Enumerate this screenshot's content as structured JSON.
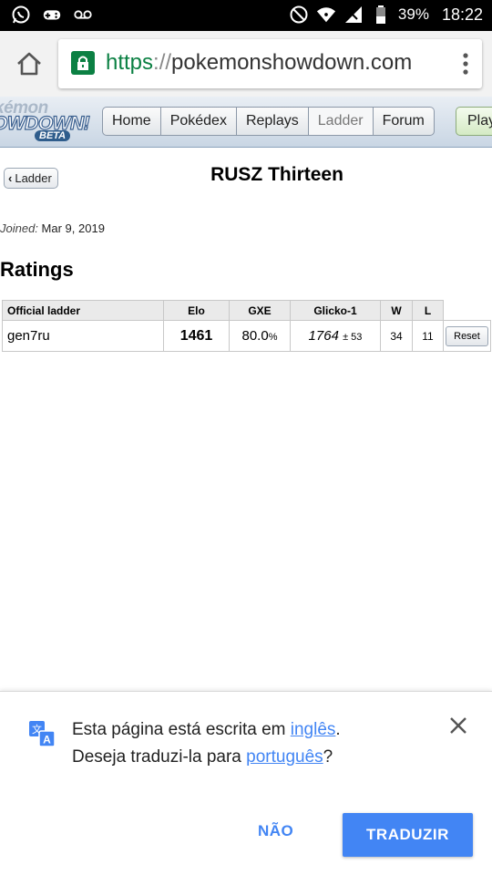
{
  "status_bar": {
    "battery": "39%",
    "time": "18:22",
    "icons": [
      "whatsapp-icon",
      "game-controller-icon",
      "voicemail-icon",
      "do-not-disturb-icon",
      "wifi-icon",
      "signal-icon",
      "battery-icon"
    ]
  },
  "browser": {
    "url_scheme": "https",
    "url_sep": "://",
    "url_host": "pokemonshowdown.com",
    "colors": {
      "secure": "#0b8043"
    }
  },
  "site_header": {
    "logo_line1": "kémon",
    "logo_line2": "OWDOWN!",
    "logo_line3": "BETA",
    "nav": [
      "Home",
      "Pokédex",
      "Replays",
      "Ladder",
      "Forum"
    ],
    "current_nav": "Ladder",
    "play_label": "Play"
  },
  "profile": {
    "back_label": "Ladder",
    "username": "RUSZ Thirteen",
    "joined_label": "Joined:",
    "joined_date": "Mar 9, 2019",
    "ratings_heading": "Ratings"
  },
  "ladder_table": {
    "headers": [
      "Official ladder",
      "Elo",
      "GXE",
      "Glicko-1",
      "W",
      "L"
    ],
    "rows": [
      {
        "format": "gen7ru",
        "elo": "1461",
        "gxe": "80.0",
        "gxe_unit": "%",
        "glicko": "1764",
        "glicko_dev": "± 53",
        "w": "34",
        "l": "11",
        "action": "Reset"
      }
    ]
  },
  "translate_bar": {
    "line1_prefix": "Esta página está escrita em ",
    "source_lang": "inglês",
    "line1_suffix": ".",
    "line2_prefix": "Deseja traduzi-la para ",
    "target_lang": "português",
    "line2_suffix": "?",
    "decline_label": "NÃO",
    "accept_label": "TRADUZIR",
    "colors": {
      "accent": "#4285f4"
    }
  }
}
